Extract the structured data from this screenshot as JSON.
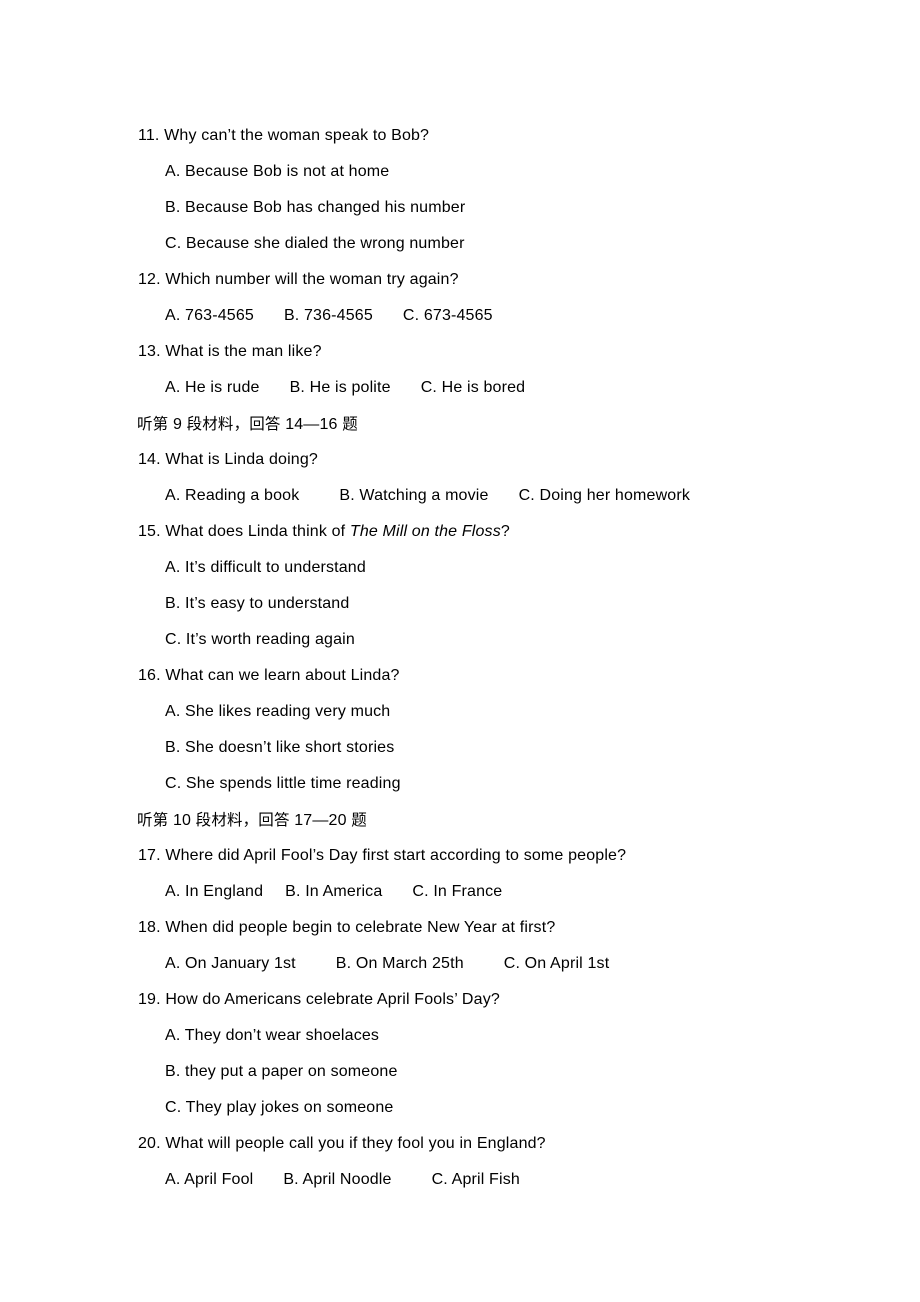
{
  "document": {
    "type": "listening-comprehension-question-sheet",
    "language_mix": [
      "en",
      "zh"
    ]
  },
  "questions": [
    {
      "number": "11.",
      "text": "11. Why can’t the woman speak to Bob?",
      "layout": "stacked",
      "options": [
        "A. Because Bob is not at home",
        "B. Because Bob has changed his number",
        "C. Because she dialed the wrong number"
      ]
    },
    {
      "number": "12.",
      "text": "12. Which number will the woman try again?",
      "layout": "inline",
      "options": [
        "A. 763-4565",
        "B. 736-4565",
        "C. 673-4565"
      ]
    },
    {
      "number": "13.",
      "text": "13. What is the man like?",
      "layout": "inline",
      "options": [
        "A. He is rude",
        "B. He is polite",
        "C. He is bored"
      ]
    },
    {
      "number": "14.",
      "text": "14. What is Linda doing?",
      "layout": "inline",
      "options": [
        "A. Reading a book",
        "B. Watching a movie",
        "C. Doing her homework"
      ]
    },
    {
      "number": "15.",
      "text_before_title": "15. What does Linda think of ",
      "italic_title": "The Mill on the Floss",
      "text_after_title": "?",
      "layout": "stacked",
      "options": [
        "A. It’s difficult to understand",
        "B. It’s easy to understand",
        "C. It’s worth reading again"
      ]
    },
    {
      "number": "16.",
      "text": "16. What can we learn about Linda?",
      "layout": "stacked",
      "options": [
        "A. She likes reading very much",
        "B. She doesn’t like short stories",
        "C. She spends little time reading"
      ]
    },
    {
      "number": "17.",
      "text": "17. Where did April Fool’s Day first start according to some people?",
      "layout": "inline",
      "options": [
        "A. In England",
        "B. In America",
        "C. In France"
      ]
    },
    {
      "number": "18.",
      "text": "18. When did people begin to celebrate New Year at first?",
      "layout": "inline",
      "options": [
        "A. On January 1st",
        "B. On March 25th",
        "C. On April 1st"
      ]
    },
    {
      "number": "19.",
      "text": "19. How do Americans celebrate April Fools’ Day?",
      "layout": "stacked",
      "options": [
        "A. They don’t wear shoelaces",
        "B. they put a paper on someone",
        "C. They play jokes on someone"
      ]
    },
    {
      "number": "20.",
      "text": "20. What will people call you if they fool you in England?",
      "layout": "inline",
      "options": [
        "A. April Fool",
        "B. April Noodle",
        "C. April Fish"
      ]
    }
  ],
  "section_headings": [
    {
      "id": "section-9",
      "prefix_cjk": "听第",
      "material_number": "9",
      "middle_cjk": "段材料，回答",
      "question_range": "14—16",
      "suffix_cjk": "题",
      "full_text": "听第 9 段材料，回答 14—16 题"
    },
    {
      "id": "section-10",
      "prefix_cjk": "听第",
      "material_number": "10",
      "middle_cjk": "段材料，回答",
      "question_range": "17—20",
      "suffix_cjk": "题",
      "full_text": "听第 10 段材料，回答 17—20 题"
    }
  ],
  "colors": {
    "text": "#000000",
    "background": "#ffffff"
  }
}
